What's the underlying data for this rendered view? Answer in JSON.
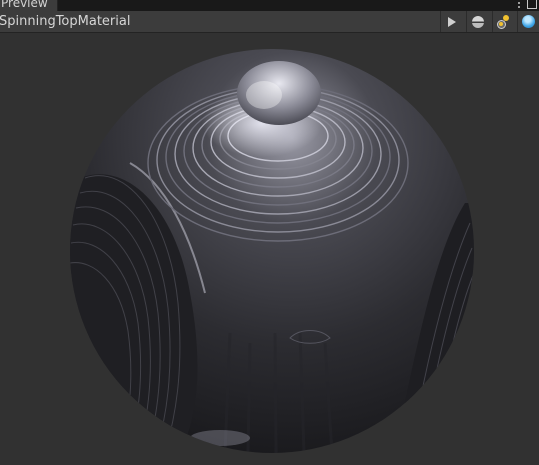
{
  "tab": {
    "label": "Preview"
  },
  "toolbar": {
    "title": "SpinningTopMaterial",
    "buttons": [
      {
        "name": "play",
        "icon": "play-icon"
      },
      {
        "name": "preview-shape",
        "icon": "sphere-icon"
      },
      {
        "name": "preview-lights",
        "icon": "lights-icon"
      },
      {
        "name": "preview-skybox",
        "icon": "skybox-icon"
      }
    ]
  },
  "window_controls": {
    "menu_icon": "kebab-icon",
    "maximize_icon": "maximize-icon"
  },
  "colors": {
    "panel_bg": "#282828",
    "toolbar_bg": "#3c3c3c",
    "viewport_bg": "#313131",
    "sphere_base": "#2d2d31",
    "highlight": "#d8d8e4"
  }
}
